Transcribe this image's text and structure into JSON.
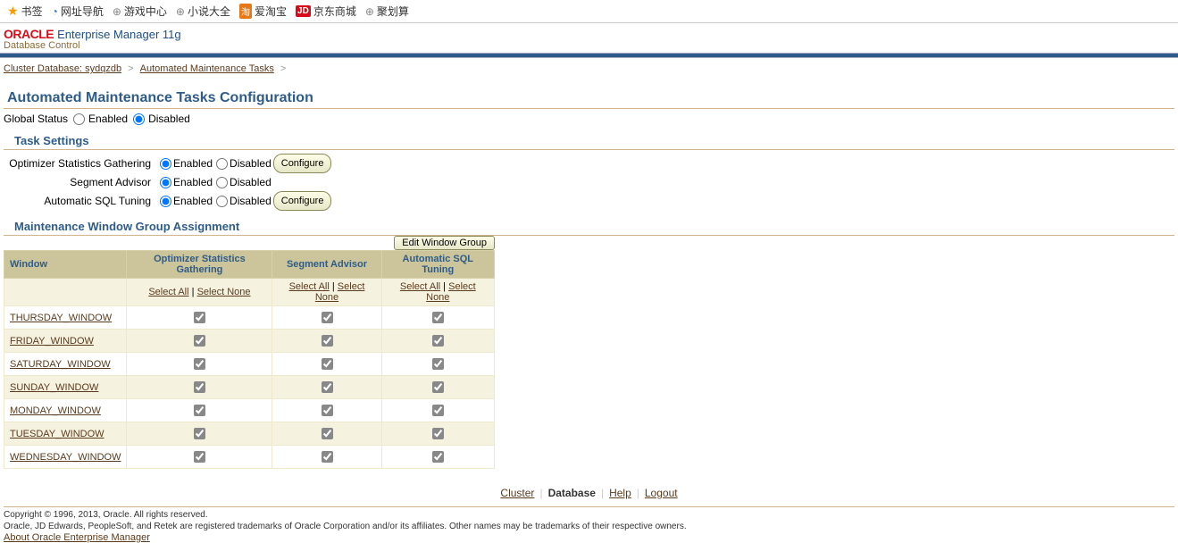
{
  "bookmarks": {
    "items": [
      {
        "label": "书签",
        "icon": "star"
      },
      {
        "label": "网址导航",
        "icon": "sog"
      },
      {
        "label": "游戏中心",
        "icon": "globe"
      },
      {
        "label": "小说大全",
        "icon": "globe"
      },
      {
        "label": "爱淘宝",
        "icon": "xun"
      },
      {
        "label": "京东商城",
        "icon": "jd"
      },
      {
        "label": "聚划算",
        "icon": "globe"
      }
    ]
  },
  "header": {
    "oracle": "ORACLE",
    "product": "Enterprise Manager 11g",
    "subtitle": "Database Control"
  },
  "breadcrumbs": {
    "items": [
      {
        "label": "Cluster Database: sydqzdb",
        "link": true
      },
      {
        "label": "Automated Maintenance Tasks",
        "link": true
      }
    ],
    "sep": ">"
  },
  "page_title": "Automated Maintenance Tasks Configuration",
  "global_status": {
    "label": "Global Status",
    "enabled": "Enabled",
    "disabled": "Disabled",
    "selected": "disabled"
  },
  "task_settings": {
    "title": "Task Settings",
    "rows": [
      {
        "label": "Optimizer Statistics Gathering",
        "enabled": "Enabled",
        "disabled": "Disabled",
        "selected": "enabled",
        "configure": true
      },
      {
        "label": "Segment Advisor",
        "enabled": "Enabled",
        "disabled": "Disabled",
        "selected": "enabled",
        "configure": false
      },
      {
        "label": "Automatic SQL Tuning",
        "enabled": "Enabled",
        "disabled": "Disabled",
        "selected": "enabled",
        "configure": true
      }
    ],
    "configure_label": "Configure"
  },
  "window_group": {
    "title": "Maintenance Window Group Assignment",
    "edit_button": "Edit Window Group",
    "col_window": "Window",
    "columns": [
      "Optimizer Statistics Gathering",
      "Segment Advisor",
      "Automatic SQL Tuning"
    ],
    "select_all": "Select All",
    "select_none": "Select None",
    "rows": [
      {
        "name": "THURSDAY_WINDOW",
        "checks": [
          true,
          true,
          true
        ]
      },
      {
        "name": "FRIDAY_WINDOW",
        "checks": [
          true,
          true,
          true
        ]
      },
      {
        "name": "SATURDAY_WINDOW",
        "checks": [
          true,
          true,
          true
        ]
      },
      {
        "name": "SUNDAY_WINDOW",
        "checks": [
          true,
          true,
          true
        ]
      },
      {
        "name": "MONDAY_WINDOW",
        "checks": [
          true,
          true,
          true
        ]
      },
      {
        "name": "TUESDAY_WINDOW",
        "checks": [
          true,
          true,
          true
        ]
      },
      {
        "name": "WEDNESDAY_WINDOW",
        "checks": [
          true,
          true,
          true
        ]
      }
    ]
  },
  "footer": {
    "links": [
      {
        "label": "Cluster",
        "current": false
      },
      {
        "label": "Database",
        "current": true
      },
      {
        "label": "Help",
        "current": false
      },
      {
        "label": "Logout",
        "current": false
      }
    ],
    "sep": "|",
    "copyright1": "Copyright © 1996, 2013, Oracle. All rights reserved.",
    "copyright2": "Oracle, JD Edwards, PeopleSoft, and Retek are registered trademarks of Oracle Corporation and/or its affiliates. Other names may be trademarks of their respective owners.",
    "about": "About Oracle Enterprise Manager"
  }
}
